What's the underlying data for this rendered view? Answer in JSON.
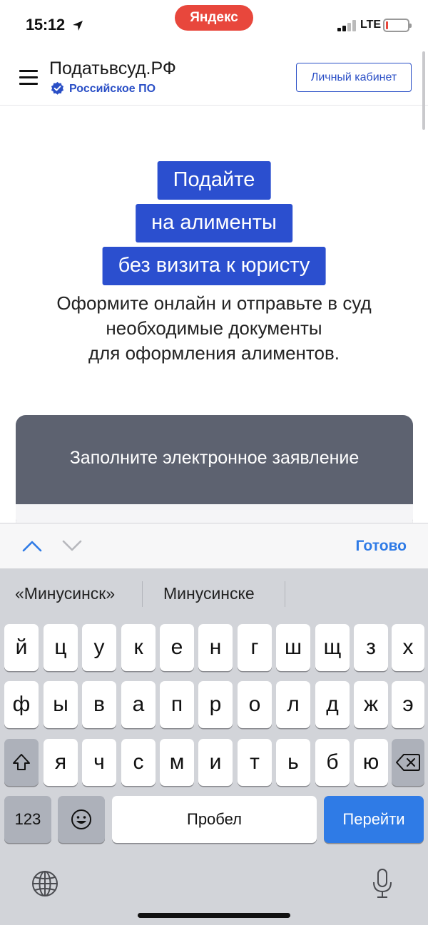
{
  "status_bar": {
    "time": "15:12",
    "browser_pill": "Яндекс",
    "network": "LTE"
  },
  "header": {
    "brand": "Податьвсуд.РФ",
    "verified_label": "Российское ПО",
    "cabinet_button": "Личный кабинет"
  },
  "hero": {
    "line1": "Подайте",
    "line2": "на алименты",
    "line3": "без визита к юристу",
    "subtitle_lines": [
      "Оформите онлайн и отправьте в суд",
      "необходимые документы",
      "для оформления алиментов."
    ]
  },
  "form_card": {
    "title": "Заполните электронное заявление"
  },
  "accessory": {
    "done_label": "Готово"
  },
  "keyboard": {
    "suggestions": [
      "«Минусинск»",
      "Минусинске"
    ],
    "row1": [
      "й",
      "ц",
      "у",
      "к",
      "е",
      "н",
      "г",
      "ш",
      "щ",
      "з",
      "х"
    ],
    "row2": [
      "ф",
      "ы",
      "в",
      "а",
      "п",
      "р",
      "о",
      "л",
      "д",
      "ж",
      "э"
    ],
    "row3": [
      "я",
      "ч",
      "с",
      "м",
      "и",
      "т",
      "ь",
      "б",
      "ю"
    ],
    "numbers_key": "123",
    "space_key": "Пробел",
    "go_key": "Перейти"
  },
  "colors": {
    "brand_blue": "#2b4fcf",
    "ios_blue": "#2f7be6",
    "yandex_red": "#e8473c",
    "card_gray": "#5d6270"
  }
}
